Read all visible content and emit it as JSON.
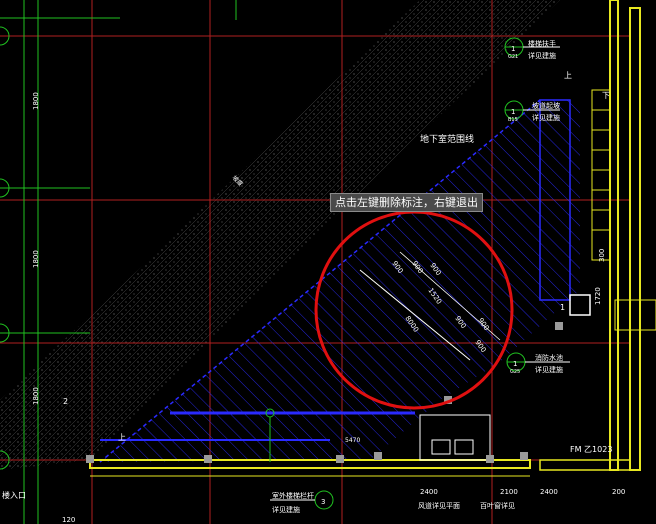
{
  "tooltip": {
    "text": "点击左键删除标注，右键退出"
  },
  "labels": {
    "basement_boundary": "地下室范围线",
    "fire_pool": "消防水池",
    "outdoor_stairs": "室外楼梯栏杆",
    "see_detail": "详见建施",
    "left_entrance": "楼入口",
    "ramp_note": "坡道起坡",
    "stair_note": "楼梯扶手",
    "bottom_right_note": "百叶窗详见",
    "bottom_left_note": "风道详见平面",
    "fm_code": "FM 乙1023",
    "dim_1800_a": "1800",
    "dim_1800_b": "1800",
    "dim_1800_c": "1800",
    "dim_2400_a": "2400",
    "dim_2100": "2100",
    "dim_2400_b": "2400",
    "dim_200": "200",
    "dim_1720": "1720",
    "dim_300": "300",
    "dim_120": "120",
    "ann_900_a": "900",
    "ann_900_b": "900",
    "ann_900_c": "900",
    "ann_1520": "1520",
    "ann_8000": "8000",
    "ann_900_d": "900",
    "ann_900_e": "900",
    "ann_900_f": "900",
    "level_up_a": "上",
    "level_up_b": "上",
    "level_down": "下",
    "slope_label": "坡度",
    "small_dim": "5470",
    "dim_2": "2",
    "dim_1": "1"
  },
  "markers": [
    {
      "num": "1",
      "sub": "G21"
    },
    {
      "num": "1",
      "sub": "B15"
    },
    {
      "num": "1",
      "sub": "G25"
    },
    {
      "num": "3",
      "sub": ""
    }
  ],
  "colors": {
    "background": "#000000",
    "grid_red": "#b02020",
    "grid_green": "#20c020",
    "hatch_blue": "#2a2aff",
    "wall_yellow": "#e8e820",
    "highlight_circle": "#e01010",
    "text": "#ffffff"
  }
}
